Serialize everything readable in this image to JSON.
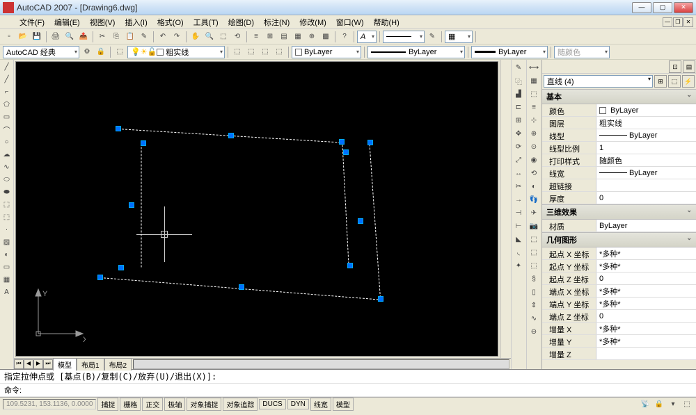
{
  "title": "AutoCAD 2007 - [Drawing6.dwg]",
  "menu": [
    "文件(F)",
    "编辑(E)",
    "视图(V)",
    "插入(I)",
    "格式(O)",
    "工具(T)",
    "绘图(D)",
    "标注(N)",
    "修改(M)",
    "窗口(W)",
    "帮助(H)"
  ],
  "workspace_dropdown": "AutoCAD 经典",
  "layer_dropdown": "粗实线",
  "bylayer1": "ByLayer",
  "bylayer2": "ByLayer",
  "bylayer3": "ByLayer",
  "color_dropdown": "随颜色",
  "tabs": {
    "model": "模型",
    "layout1": "布局1",
    "layout2": "布局2"
  },
  "ucs": {
    "x": "X",
    "y": "Y"
  },
  "cmd1": "指定拉伸点或 [基点(B)/复制(C)/放弃(U)/退出(X)]:",
  "cmd2": "命令:",
  "status_coord": "109.5231, 153.1136, 0.0000",
  "status_toggles": [
    "捕捉",
    "栅格",
    "正交",
    "极轴",
    "对象捕捉",
    "对象追踪",
    "DUCS",
    "DYN",
    "线宽",
    "模型"
  ],
  "properties": {
    "selector": "直线 (4)",
    "sec_basic": "基本",
    "sec_3d": "三维效果",
    "sec_geom": "几何图形",
    "rows_basic": [
      {
        "k": "颜色",
        "v": "ByLayer",
        "swatch": true
      },
      {
        "k": "图层",
        "v": "粗实线"
      },
      {
        "k": "线型",
        "v": "ByLayer",
        "line": true
      },
      {
        "k": "线型比例",
        "v": "1"
      },
      {
        "k": "打印样式",
        "v": "随颜色"
      },
      {
        "k": "线宽",
        "v": "ByLayer",
        "line": true
      },
      {
        "k": "超链接",
        "v": ""
      },
      {
        "k": "厚度",
        "v": "0"
      }
    ],
    "rows_3d": [
      {
        "k": "材质",
        "v": "ByLayer"
      }
    ],
    "rows_geom": [
      {
        "k": "起点 X 坐标",
        "v": "*多种*"
      },
      {
        "k": "起点 Y 坐标",
        "v": "*多种*"
      },
      {
        "k": "起点 Z 坐标",
        "v": "0"
      },
      {
        "k": "端点 X 坐标",
        "v": "*多种*"
      },
      {
        "k": "端点 Y 坐标",
        "v": "*多种*"
      },
      {
        "k": "端点 Z 坐标",
        "v": "0"
      },
      {
        "k": "增量 X",
        "v": "*多种*"
      },
      {
        "k": "增量 Y",
        "v": "*多种*"
      },
      {
        "k": "增量 Z",
        "v": ""
      }
    ]
  },
  "chart_data": null
}
